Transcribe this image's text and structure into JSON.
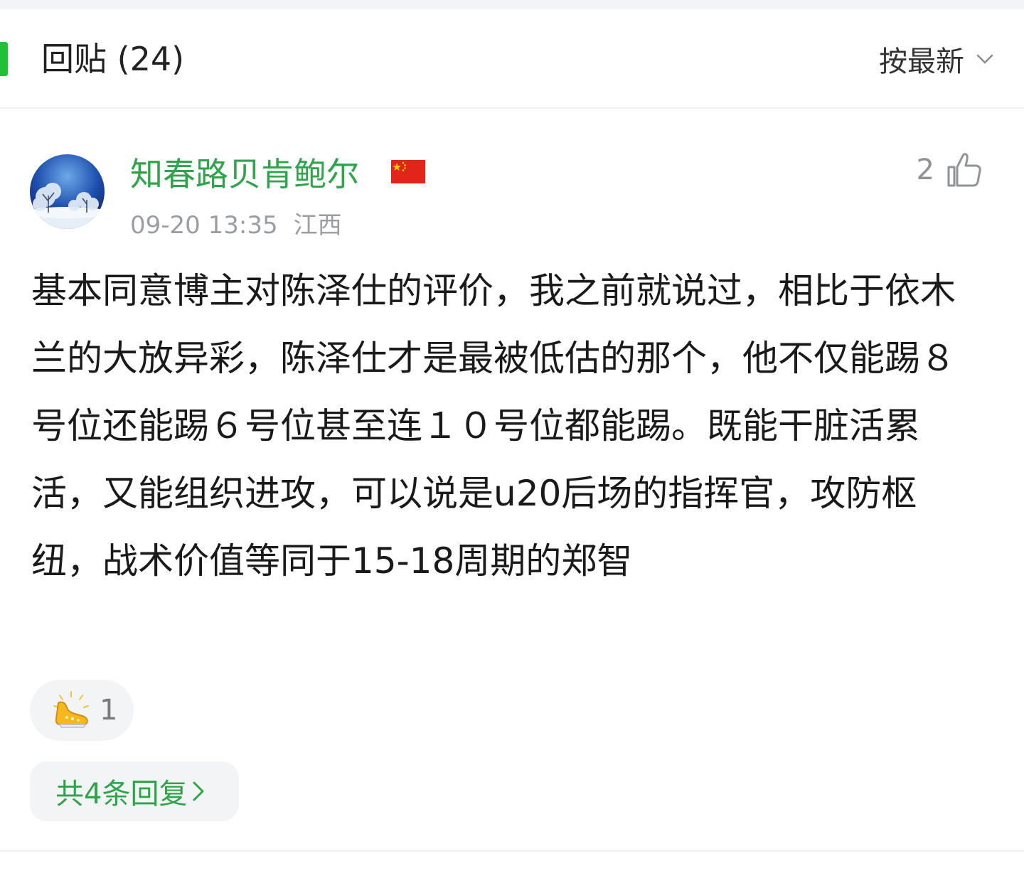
{
  "header": {
    "title": "回贴 (24)",
    "sort_label": "按最新",
    "accent_color": "#21c037"
  },
  "comment": {
    "username": "知春路贝肯鲍尔",
    "flag_icon": "china-flag-icon",
    "timestamp": "09-20 13:35",
    "location": "江西",
    "like_count": "2",
    "body": "基本同意博主对陈泽仕的评价，我之前就说过，相比于依木兰的大放异彩，陈泽仕才是最被低估的那个，他不仅能踢８号位还能踢６号位甚至连１０号位都能踢。既能干脏活累活，又能组织进攻，可以说是u20后场的指挥官，攻防枢纽，战术价值等同于15-18周期的郑智",
    "reaction": {
      "icon": "golden-boot-icon",
      "count": "1"
    },
    "replies_label": "共4条回复",
    "username_color": "#2fa44a"
  }
}
